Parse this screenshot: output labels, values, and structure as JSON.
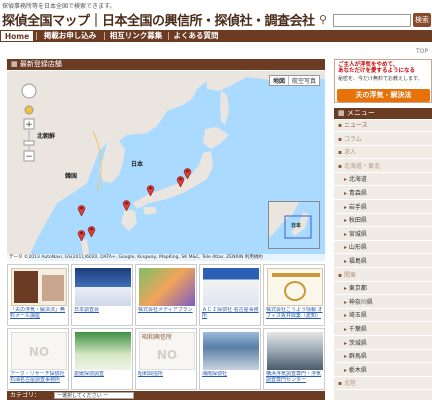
{
  "header": {
    "tagline": "探偵事務所等を日本全国で検索できます。",
    "title": "探偵全国マップ｜日本全国の興信所・探偵社・調査会社",
    "search_placeholder": "",
    "search_button": "検索"
  },
  "nav": {
    "items": [
      "Home",
      "掲載お申し込み",
      "相互リンク募集",
      "よくある質問"
    ],
    "active": "Home"
  },
  "top_link": "TOP",
  "main": {
    "panel_title": "最新登録店舗",
    "map": {
      "type_buttons": [
        "地図",
        "航空写真"
      ],
      "labels": {
        "north_korea": "北朝鮮",
        "korea": "韓国",
        "japan": "日本",
        "inset": "日本"
      },
      "copyright": "データ ©2013 AutoNavi, GS(2011)6020, DATA+, Google, Kingway, MapKing, SK M&C, Tele Atlas, ZENRIN 利用規約"
    }
  },
  "listings": [
    {
      "caption": "「夫の浮気・解決法」無料メール講座",
      "photo": "book-cover"
    },
    {
      "caption": "日本調査会",
      "photo": "photo"
    },
    {
      "caption": "株式会社メディアプラン",
      "photo": "photo"
    },
    {
      "caption": "ＡＣＩ探偵社 名古屋事務所",
      "photo": "photo"
    },
    {
      "caption": "株式会社こうよう情報 オフィス坂井興業（愛知）",
      "photo": "flyer"
    },
    {
      "caption": "アーク・リサーチ探偵社 石油名古屋調査事務所",
      "photo": "NO PHOTO"
    },
    {
      "caption": "愛媛探偵調査",
      "photo": "photo"
    },
    {
      "caption": "昭和興信所",
      "photo": "NO PHOTO",
      "title": "昭和興信所"
    },
    {
      "caption": "湘南探偵社",
      "photo": "photo"
    },
    {
      "caption": "横浜浮気調査専門・浮気調査専門センター",
      "photo": "photo"
    }
  ],
  "category_bar": {
    "label": "カテゴリ：",
    "select_value": "ー選択してください ー"
  },
  "sidebar": {
    "ad": {
      "line1": "ご主人が浮気をやめて、",
      "line2": "あなただけを愛するようになる",
      "line3": "秘密を、今だけ無料でお教えします。",
      "banner": "夫の浮気・解決法"
    },
    "menu_title": "メニュー",
    "items": [
      {
        "label": "ニュース",
        "kind": "link"
      },
      {
        "label": "コラム",
        "kind": "cat"
      },
      {
        "label": "求人",
        "kind": "cat"
      },
      {
        "label": "北海道・東北",
        "kind": "cat"
      },
      {
        "label": "北海道",
        "kind": "pref"
      },
      {
        "label": "青森県",
        "kind": "pref"
      },
      {
        "label": "岩手県",
        "kind": "pref"
      },
      {
        "label": "秋田県",
        "kind": "pref"
      },
      {
        "label": "宮城県",
        "kind": "pref"
      },
      {
        "label": "山形県",
        "kind": "pref"
      },
      {
        "label": "福島県",
        "kind": "pref"
      },
      {
        "label": "関東",
        "kind": "cat"
      },
      {
        "label": "東京都",
        "kind": "pref"
      },
      {
        "label": "神奈川県",
        "kind": "pref"
      },
      {
        "label": "埼玉県",
        "kind": "pref"
      },
      {
        "label": "千葉県",
        "kind": "pref"
      },
      {
        "label": "茨城県",
        "kind": "pref"
      },
      {
        "label": "群馬県",
        "kind": "pref"
      },
      {
        "label": "栃木県",
        "kind": "pref"
      },
      {
        "label": "北陸",
        "kind": "cat"
      }
    ]
  },
  "colors": {
    "brand": "#6b3b24",
    "accent": "#e8710a",
    "link": "#2a5db0",
    "pin": "#d9403a"
  }
}
